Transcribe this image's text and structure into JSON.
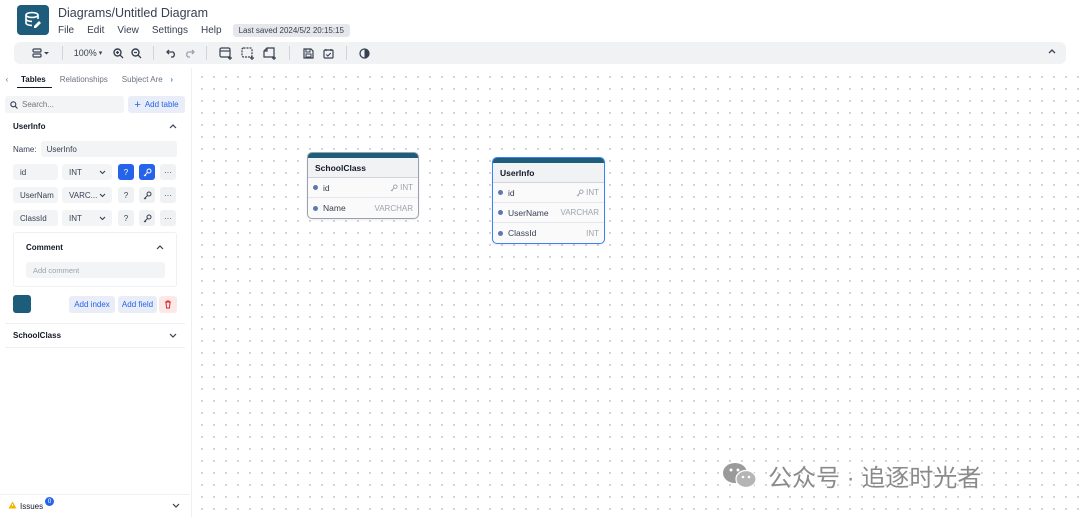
{
  "header": {
    "title": "Diagrams/Untitled Diagram",
    "menu": [
      "File",
      "Edit",
      "View",
      "Settings",
      "Help"
    ],
    "last_saved": "Last saved 2024/5/2 20:15:15"
  },
  "toolbar": {
    "zoom": "100%"
  },
  "sidebar": {
    "tabs": [
      "Tables",
      "Relationships",
      "Subject Are"
    ],
    "search_placeholder": "Search...",
    "add_table_label": "Add table",
    "selected_table": {
      "title": "UserInfo",
      "name_label": "Name:",
      "name_value": "UserInfo",
      "fields": [
        {
          "name": "id",
          "type": "INT"
        },
        {
          "name": "UserNam",
          "type": "VARC..."
        },
        {
          "name": "ClassId",
          "type": "INT"
        }
      ],
      "comment_label": "Comment",
      "comment_placeholder": "Add comment",
      "color": "#1d5c7a",
      "add_index_label": "Add index",
      "add_field_label": "Add field"
    },
    "other_tables": [
      "SchoolClass"
    ],
    "issues_label": "Issues",
    "issues_count": "0"
  },
  "canvas": {
    "tables": [
      {
        "title": "SchoolClass",
        "rows": [
          {
            "name": "id",
            "type": "INT",
            "key": true
          },
          {
            "name": "Name",
            "type": "VARCHAR",
            "key": false
          }
        ]
      },
      {
        "title": "UserInfo",
        "rows": [
          {
            "name": "id",
            "type": "INT",
            "key": true
          },
          {
            "name": "UserName",
            "type": "VARCHAR",
            "key": false
          },
          {
            "name": "ClassId",
            "type": "INT",
            "key": false
          }
        ]
      }
    ]
  },
  "watermark": "公众号 · 追逐时光者",
  "colors": {
    "brand": "#1d5c7a",
    "accent": "#2563eb"
  }
}
